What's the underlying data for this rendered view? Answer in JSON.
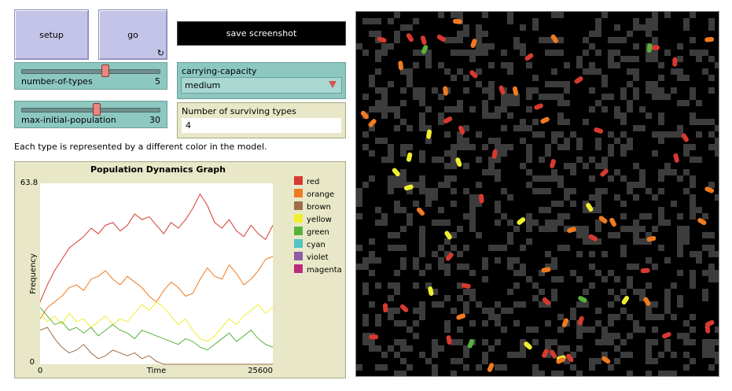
{
  "buttons": {
    "setup_label": "setup",
    "go_label": "go",
    "go_forever_icon": "forever-icon",
    "screenshot_label": "save screenshot"
  },
  "sliders": [
    {
      "label": "number-of-types",
      "value": "5",
      "fraction": 0.62
    },
    {
      "label": "max-initial-population",
      "value": "30",
      "fraction": 0.55
    }
  ],
  "chooser": {
    "label": "carrying-capacity",
    "value": "medium"
  },
  "monitor": {
    "label": "Number of surviving types",
    "value": "4"
  },
  "note": "Each type is represented by a different color in the model.",
  "chart_data": {
    "type": "line",
    "title": "Population Dynamics Graph",
    "xlabel": "Time",
    "ylabel": "Frequency",
    "xlim": [
      0,
      25600
    ],
    "ylim": [
      0,
      63.8
    ],
    "x_tick_labels": [
      "0",
      "25600"
    ],
    "y_tick_labels": [
      "0",
      "63.8"
    ],
    "legend_position": "right",
    "series": [
      {
        "name": "red",
        "color": "#d73a30",
        "x": [
          0,
          800,
          1600,
          2400,
          3200,
          4000,
          4800,
          5600,
          6400,
          7200,
          8000,
          8800,
          9600,
          10400,
          11200,
          12000,
          12800,
          13600,
          14400,
          15200,
          16000,
          16800,
          17600,
          18400,
          19200,
          20000,
          20800,
          21600,
          22400,
          23200,
          24000,
          24800,
          25600
        ],
        "values": [
          22,
          28,
          33,
          37,
          41,
          43,
          45,
          48,
          46,
          49,
          50,
          47,
          49,
          53,
          51,
          52,
          49,
          46,
          50,
          48,
          51,
          55,
          60,
          56,
          50,
          48,
          51,
          47,
          45,
          49,
          46,
          44,
          49
        ]
      },
      {
        "name": "orange",
        "color": "#ef7a22",
        "x": [
          0,
          800,
          1600,
          2400,
          3200,
          4000,
          4800,
          5600,
          6400,
          7200,
          8000,
          8800,
          9600,
          10400,
          11200,
          12000,
          12800,
          13600,
          14400,
          15200,
          16000,
          16800,
          17600,
          18400,
          19200,
          20000,
          20800,
          21600,
          22400,
          23200,
          24000,
          24800,
          25600
        ],
        "values": [
          16,
          20,
          22,
          24,
          27,
          28,
          26,
          30,
          31,
          33,
          30,
          28,
          31,
          29,
          27,
          24,
          22,
          26,
          29,
          27,
          24,
          25,
          30,
          34,
          31,
          30,
          35,
          32,
          28,
          30,
          33,
          37,
          38
        ]
      },
      {
        "name": "brown",
        "color": "#9d6e48",
        "x": [
          0,
          800,
          1600,
          2400,
          3200,
          4000,
          4800,
          5600,
          6400,
          7200,
          8000,
          8800,
          9600,
          10400,
          11200,
          12000,
          12800,
          13600,
          14400,
          15200,
          16000,
          16800,
          17600,
          18400,
          19200,
          20000,
          20800,
          21600,
          22400,
          23200,
          24000,
          24800,
          25600
        ],
        "values": [
          12,
          13,
          9,
          6,
          4,
          5,
          7,
          4,
          2,
          3,
          5,
          4,
          3,
          4,
          2,
          3,
          1,
          0,
          0,
          0,
          0,
          0,
          0,
          0,
          0,
          0,
          0,
          0,
          0,
          0,
          0,
          0,
          0
        ]
      },
      {
        "name": "yellow",
        "color": "#eeee30",
        "x": [
          0,
          800,
          1600,
          2400,
          3200,
          4000,
          4800,
          5600,
          6400,
          7200,
          8000,
          8800,
          9600,
          10400,
          11200,
          12000,
          12800,
          13600,
          14400,
          15200,
          16000,
          16800,
          17600,
          18400,
          19200,
          20000,
          20800,
          21600,
          22400,
          23200,
          24000,
          24800,
          25600
        ],
        "values": [
          18,
          15,
          17,
          14,
          18,
          15,
          16,
          13,
          15,
          17,
          14,
          16,
          15,
          18,
          21,
          19,
          22,
          20,
          17,
          14,
          16,
          12,
          9,
          8,
          10,
          13,
          16,
          14,
          17,
          19,
          21,
          18,
          20
        ]
      },
      {
        "name": "green",
        "color": "#59b03c",
        "x": [
          0,
          800,
          1600,
          2400,
          3200,
          4000,
          4800,
          5600,
          6400,
          7200,
          8000,
          8800,
          9600,
          10400,
          11200,
          12000,
          12800,
          13600,
          14400,
          15200,
          16000,
          16800,
          17600,
          18400,
          19200,
          20000,
          20800,
          21600,
          22400,
          23200,
          24000,
          24800,
          25600
        ],
        "values": [
          20,
          17,
          14,
          15,
          12,
          13,
          11,
          13,
          10,
          12,
          14,
          12,
          11,
          9,
          12,
          11,
          10,
          9,
          8,
          7,
          9,
          8,
          6,
          5,
          7,
          9,
          11,
          8,
          10,
          12,
          9,
          7,
          6
        ]
      },
      {
        "name": "cyan",
        "color": "#54c4c4",
        "x": [],
        "values": []
      },
      {
        "name": "violet",
        "color": "#8d5fa6",
        "x": [],
        "values": []
      },
      {
        "name": "magenta",
        "color": "#bb2a7b",
        "x": [],
        "values": []
      }
    ]
  },
  "world": {
    "background": "#000000",
    "patch_color": "#3c3c3c",
    "turtles": [
      {
        "type": "yellow",
        "color": "#eeee30",
        "count": 12
      },
      {
        "type": "orange",
        "color": "#ef7a22",
        "count": 24
      },
      {
        "type": "red",
        "color": "#d73a30",
        "count": 36
      },
      {
        "type": "green",
        "color": "#59b03c",
        "count": 4
      }
    ]
  }
}
